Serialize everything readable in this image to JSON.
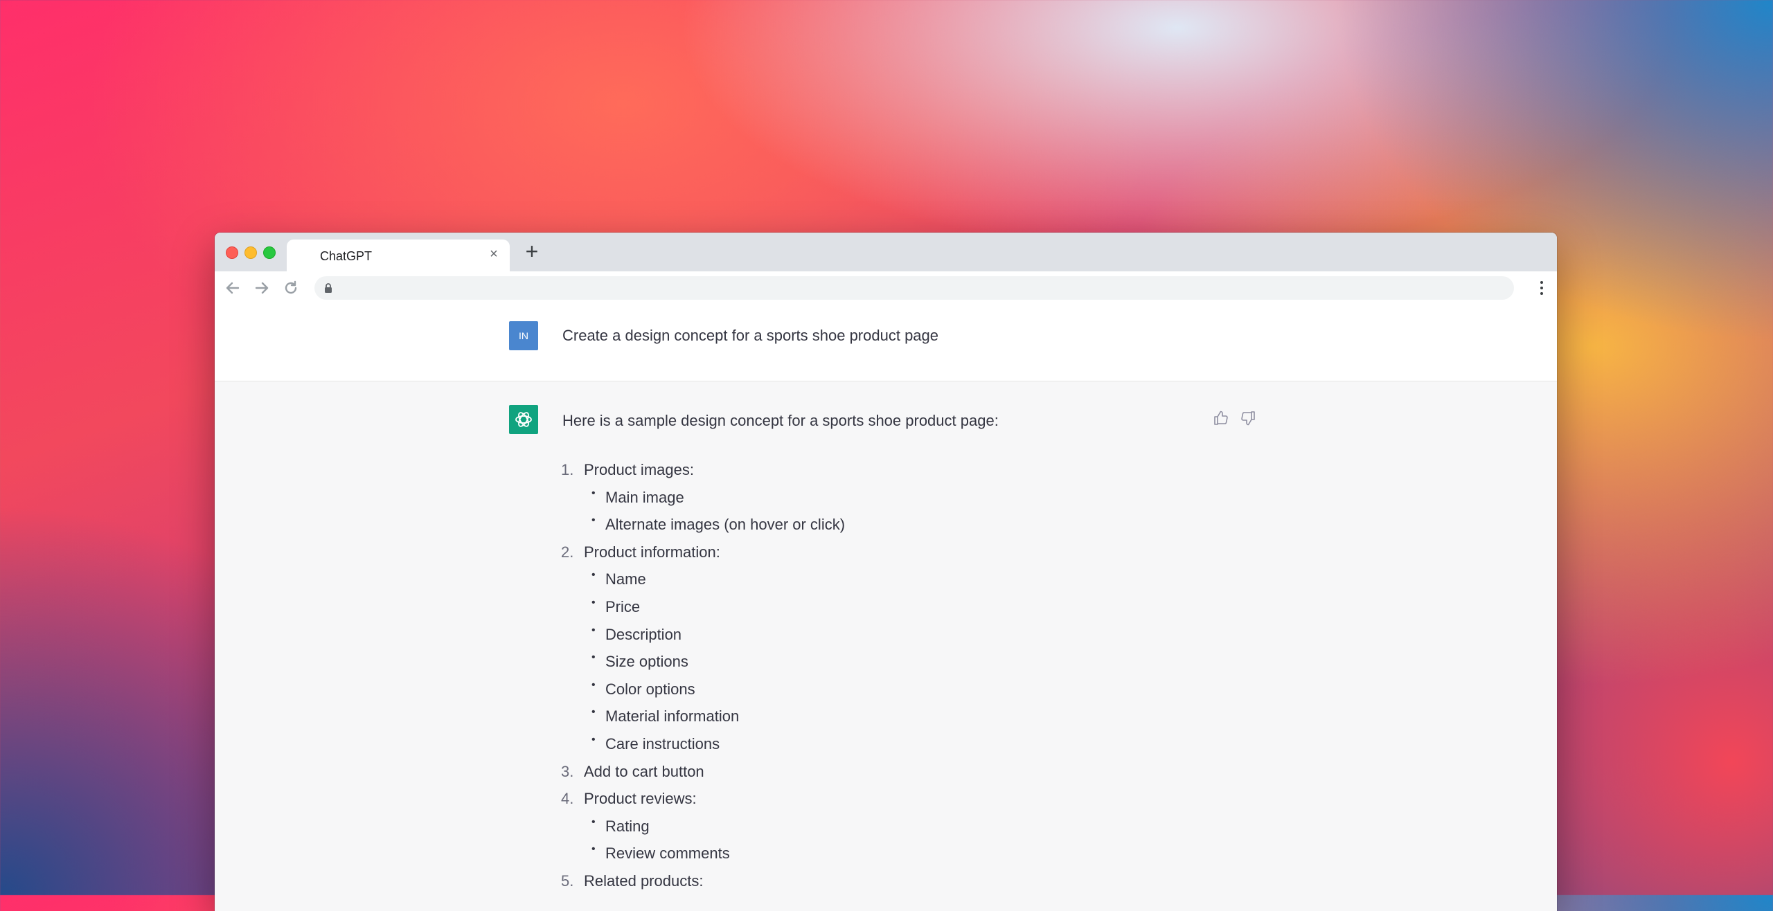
{
  "browser": {
    "tab_title": "ChatGPT",
    "tab_close": "×",
    "new_tab": "+"
  },
  "conversation": {
    "user_avatar": "IN",
    "user_message": "Create a design concept for a sports shoe product page",
    "assistant_intro": "Here is a sample design concept for a sports shoe product page:",
    "list": [
      {
        "number": "1.",
        "label": "Product images:",
        "subitems": [
          "Main image",
          "Alternate images (on hover or click)"
        ]
      },
      {
        "number": "2.",
        "label": "Product information:",
        "subitems": [
          "Name",
          "Price",
          "Description",
          "Size options",
          "Color options",
          "Material information",
          "Care instructions"
        ]
      },
      {
        "number": "3.",
        "label": "Add to cart button",
        "subitems": []
      },
      {
        "number": "4.",
        "label": "Product reviews:",
        "subitems": [
          "Rating",
          "Review comments"
        ]
      },
      {
        "number": "5.",
        "label": "Related products:",
        "subitems": []
      }
    ]
  },
  "colors": {
    "user_avatar_bg": "#4a86cf",
    "assistant_avatar_bg": "#10a37f"
  },
  "icons": [
    "back-arrow-icon",
    "forward-arrow-icon",
    "reload-icon",
    "lock-icon",
    "kebab-menu-icon",
    "thumbs-up-icon",
    "thumbs-down-icon",
    "openai-logo-icon"
  ]
}
